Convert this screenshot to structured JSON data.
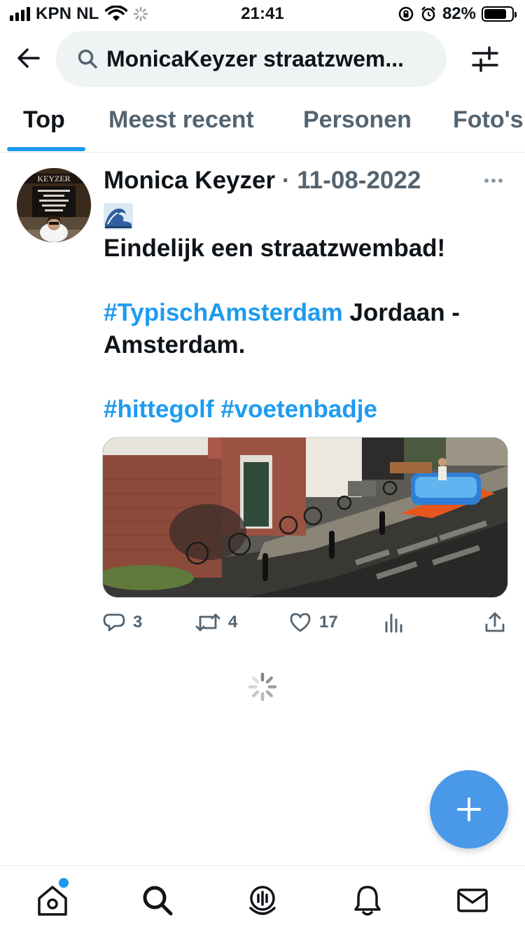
{
  "status_bar": {
    "carrier": "KPN NL",
    "time": "21:41",
    "battery_percent": "82%",
    "battery_level": 0.82
  },
  "header": {
    "search_query": "MonicaKeyzer straatzwem..."
  },
  "tabs": [
    {
      "label": "Top",
      "active": true
    },
    {
      "label": "Meest recent",
      "active": false
    },
    {
      "label": "Personen",
      "active": false
    },
    {
      "label": "Foto's",
      "active": false
    }
  ],
  "tweet": {
    "author": "Monica Keyzer",
    "separator": "·",
    "date": "11-08-2022",
    "emoji": "wave-emoji",
    "line1": "Eindelijk een straatzwembad!",
    "hashtag1": "#TypischAmsterdam",
    "line2_rest": " Jordaan -",
    "line3": "Amsterdam.",
    "hashtag2": "#hittegolf",
    "hashtag3": "#voetenbadje",
    "actions": {
      "replies": "3",
      "retweets": "4",
      "likes": "17"
    }
  },
  "colors": {
    "accent": "#1d9bf0",
    "fab": "#4a99e9",
    "muted": "#536471"
  }
}
